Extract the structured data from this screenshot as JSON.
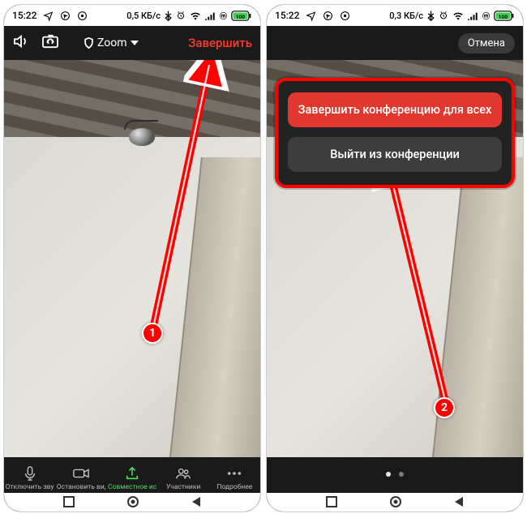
{
  "statusbar": {
    "time": "15:22",
    "data_rate_left": "0,5 КБ/с",
    "data_rate_right": "0,3 КБ/с",
    "battery_pct": "100"
  },
  "zoom_top": {
    "app_label": "Zoom",
    "end_label": "Завершить"
  },
  "zoom_bottom": {
    "mute_label": "Отключить звук",
    "stop_video_label": "Остановить видео",
    "share_label": "Совместное использование",
    "participants_label": "Участники",
    "more_label": "Подробнее"
  },
  "end_dialog": {
    "cancel_label": "Отмена",
    "end_for_all_label": "Завершить конференцию для всех",
    "leave_label": "Выйти из конференции"
  },
  "annotation": {
    "step1": "1",
    "step2": "2"
  }
}
